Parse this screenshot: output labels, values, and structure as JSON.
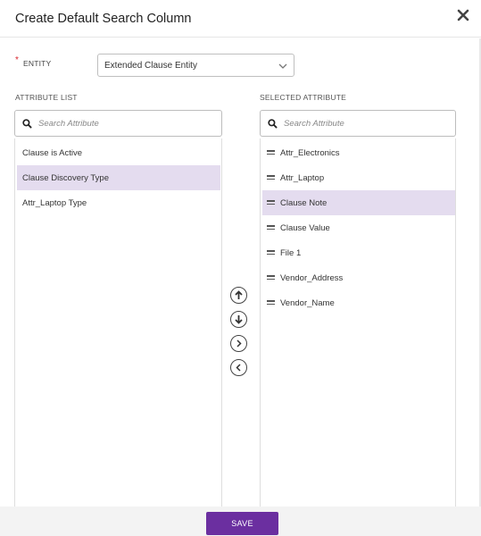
{
  "dialog": {
    "title": "Create Default Search Column",
    "close_icon": "close-icon"
  },
  "entity": {
    "required_mark": "*",
    "label": "ENTITY",
    "selected_value": "Extended Clause Entity"
  },
  "attribute_list": {
    "label": "ATTRIBUTE LIST",
    "search_placeholder": "Search Attribute",
    "items": [
      {
        "label": "Clause is Active",
        "selected": false
      },
      {
        "label": "Clause Discovery Type",
        "selected": true
      },
      {
        "label": "Attr_Laptop Type",
        "selected": false
      }
    ]
  },
  "selected_attributes": {
    "label": "SELECTED ATTRIBUTE",
    "search_placeholder": "Search Attribute",
    "items": [
      {
        "label": "Attr_Electronics",
        "selected": false
      },
      {
        "label": "Attr_Laptop",
        "selected": false
      },
      {
        "label": "Clause Note",
        "selected": true
      },
      {
        "label": "Clause Value",
        "selected": false
      },
      {
        "label": "File 1",
        "selected": false
      },
      {
        "label": "Vendor_Address",
        "selected": false
      },
      {
        "label": "Vendor_Name",
        "selected": false
      }
    ]
  },
  "transfer_controls": [
    "move-up-icon",
    "move-down-icon",
    "move-right-icon",
    "move-left-icon"
  ],
  "footer": {
    "save_label": "SAVE"
  },
  "colors": {
    "accent": "#6b2fa0",
    "selection": "#e4dcef",
    "required": "#d9262f"
  }
}
